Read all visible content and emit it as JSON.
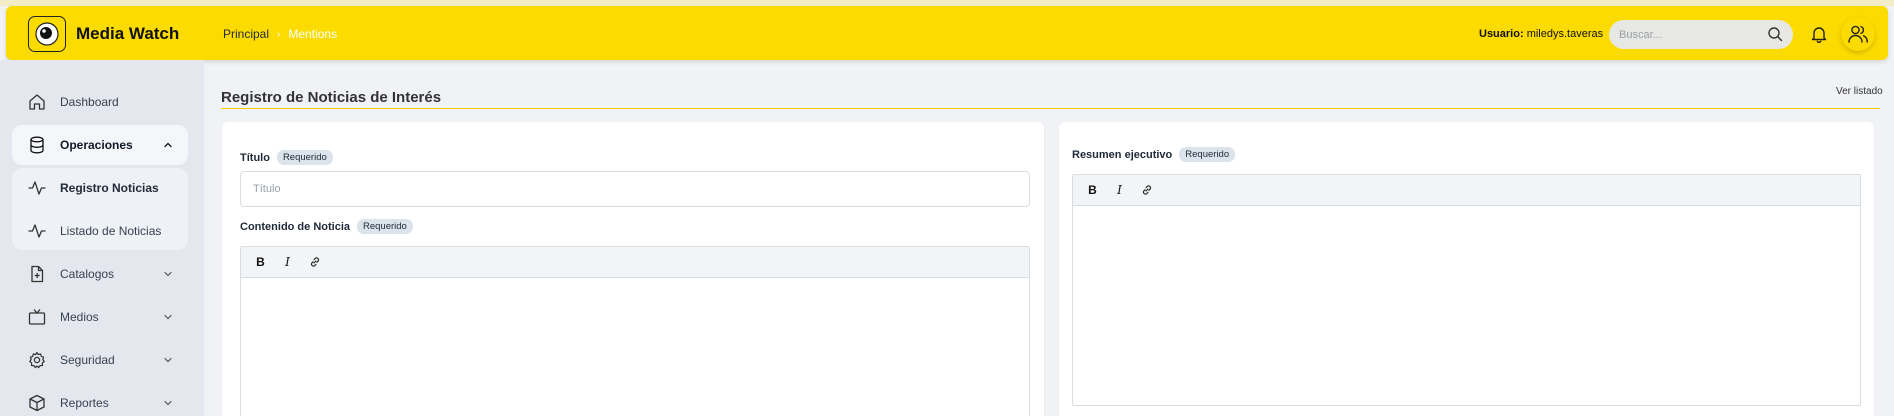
{
  "app": {
    "title": "Media Watch"
  },
  "breadcrumb": {
    "home": "Principal",
    "current": "Mentions"
  },
  "user": {
    "label": "Usuario:",
    "name": "miledys.taveras"
  },
  "search": {
    "placeholder": "Buscar..."
  },
  "sidebar": {
    "items": [
      {
        "label": "Dashboard",
        "icon": "home-icon"
      },
      {
        "label": "Operaciones",
        "icon": "database-icon",
        "expanded": true,
        "children": [
          {
            "label": "Registro Noticias",
            "icon": "activity-icon"
          },
          {
            "label": "Listado de Noticias",
            "icon": "activity-icon"
          }
        ]
      },
      {
        "label": "Catalogos",
        "icon": "file-plus-icon"
      },
      {
        "label": "Medios",
        "icon": "tv-icon"
      },
      {
        "label": "Seguridad",
        "icon": "gear-icon"
      },
      {
        "label": "Reportes",
        "icon": "box-icon"
      }
    ]
  },
  "page": {
    "title": "Registro de Noticias de Interés",
    "list_link": "Ver listado"
  },
  "form": {
    "required_badge": "Requerido",
    "title_label": "Título",
    "title_placeholder": "Título",
    "content_label": "Contenido de Noticia",
    "summary_label": "Resumen ejecutivo"
  },
  "editor_toolbar": {
    "bold": "B",
    "italic": "I",
    "link_icon": "link-icon"
  },
  "colors": {
    "brand_yellow": "#fcdb00",
    "accent_rule": "#f2cc00",
    "sidebar_bg": "#e4e8ee",
    "page_bg": "#f0f2f5"
  }
}
